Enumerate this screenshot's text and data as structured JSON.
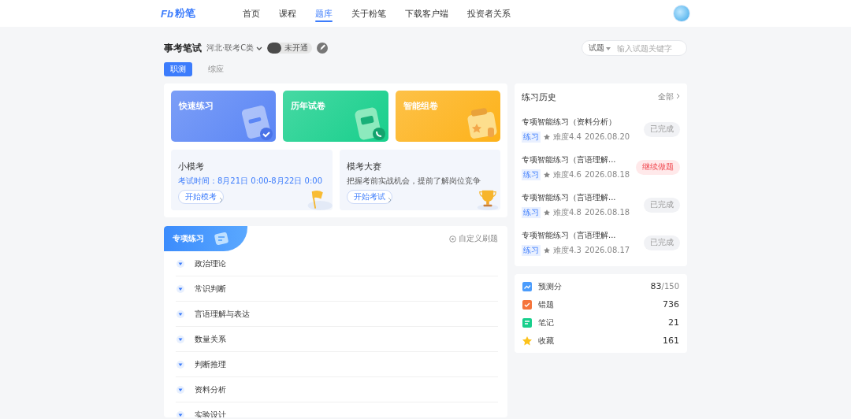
{
  "header": {
    "logo": {
      "mark": "Fb",
      "name": "粉笔"
    },
    "nav": [
      {
        "label": "首页",
        "selected": false
      },
      {
        "label": "课程",
        "selected": false
      },
      {
        "label": "题库",
        "selected": true
      },
      {
        "label": "关于粉笔",
        "selected": false
      },
      {
        "label": "下载客户端",
        "selected": false
      },
      {
        "label": "投资者关系",
        "selected": false
      }
    ]
  },
  "exam": {
    "title": "事考笔试",
    "region": "河北·联考C类",
    "badge": "未开通"
  },
  "search": {
    "scope": "试题",
    "placeholder": "输入试题关键字"
  },
  "subject_tabs": [
    {
      "label": "职测",
      "selected": true
    },
    {
      "label": "综应",
      "selected": false
    }
  ],
  "feature_cards": [
    {
      "title": "快速练习",
      "kind": "quick",
      "color": "#5b86f5"
    },
    {
      "title": "历年试卷",
      "kind": "papers",
      "color": "#18cf8c"
    },
    {
      "title": "智能组卷",
      "kind": "smart",
      "color": "#fdb21a"
    }
  ],
  "mock_cards": [
    {
      "title": "小模考",
      "desc": "考试时间：8月21日 0:00-8月22日 0:00",
      "button": "开始模考",
      "kind": "flag"
    },
    {
      "title": "模考大赛",
      "desc": "把握考前实战机会，提前了解岗位竞争",
      "button": "开始考试",
      "kind": "trophy"
    }
  ],
  "practice": {
    "title": "专项练习",
    "custom": "自定义刷题",
    "categories": [
      {
        "label": "政治理论",
        "expanded": false
      },
      {
        "label": "常识判断",
        "expanded": false
      },
      {
        "label": "言语理解与表达",
        "expanded": false
      },
      {
        "label": "数量关系",
        "expanded": false
      },
      {
        "label": "判断推理",
        "expanded": false
      },
      {
        "label": "资料分析",
        "expanded": false
      },
      {
        "label": "实验设计",
        "expanded": false
      }
    ]
  },
  "history": {
    "title": "练习历史",
    "all": "全部",
    "items": [
      {
        "title": "专项智能练习（资料分析）",
        "tag": "练习",
        "difficulty": "难度4.4",
        "date": "2026.08.20",
        "status": "已完成",
        "kind": "done"
      },
      {
        "title": "专项智能练习（言语理解...",
        "tag": "练习",
        "difficulty": "难度4.6",
        "date": "2026.08.18",
        "status": "继续做题",
        "kind": "continue"
      },
      {
        "title": "专项智能练习（言语理解...",
        "tag": "练习",
        "difficulty": "难度4.8",
        "date": "2026.08.18",
        "status": "已完成",
        "kind": "done"
      },
      {
        "title": "专项智能练习（言语理解...",
        "tag": "练习",
        "difficulty": "难度4.3",
        "date": "2026.08.17",
        "status": "已完成",
        "kind": "done"
      }
    ]
  },
  "stats": [
    {
      "label": "预测分",
      "value": "83",
      "suffix": "/150",
      "kind": "chart"
    },
    {
      "label": "错题",
      "value": "736",
      "kind": "wrong"
    },
    {
      "label": "笔记",
      "value": "21",
      "kind": "note"
    },
    {
      "label": "收藏",
      "value": "161",
      "kind": "star"
    }
  ]
}
